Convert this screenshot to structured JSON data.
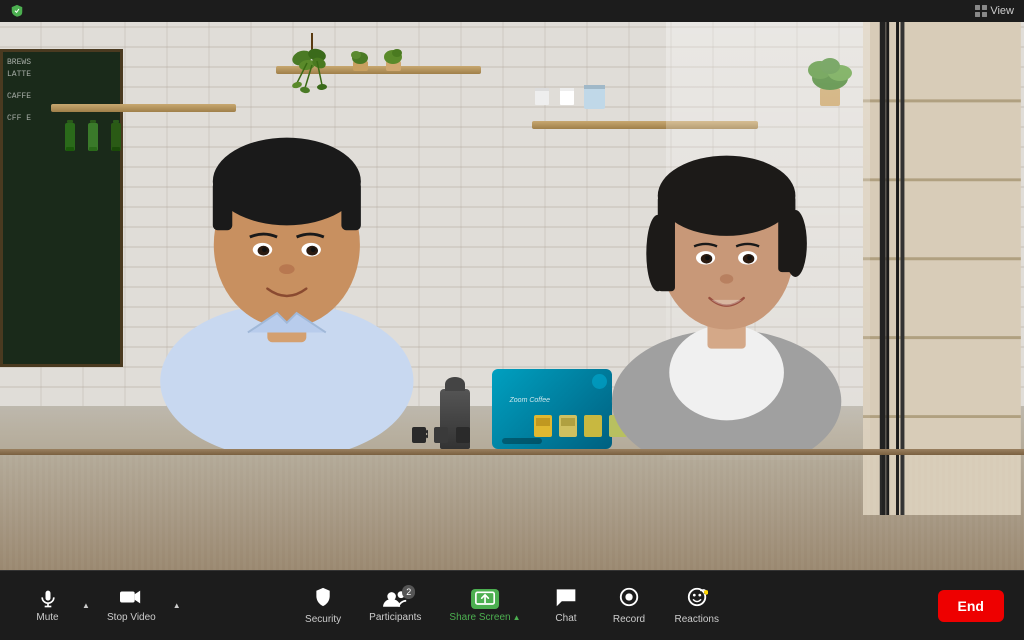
{
  "titlebar": {
    "view_label": "View",
    "shield_color": "#4CAF50"
  },
  "toolbar": {
    "mute_label": "Mute",
    "stop_video_label": "Stop Video",
    "security_label": "Security",
    "participants_label": "Participants",
    "participants_count": "2",
    "share_screen_label": "Share Screen",
    "chat_label": "Chat",
    "record_label": "Record",
    "reactions_label": "Reactions",
    "end_label": "End"
  },
  "chalkboard": {
    "line1": "BREWS",
    "line2": "LATTE",
    "line3": "CAFFE",
    "line4": "CFF E"
  }
}
